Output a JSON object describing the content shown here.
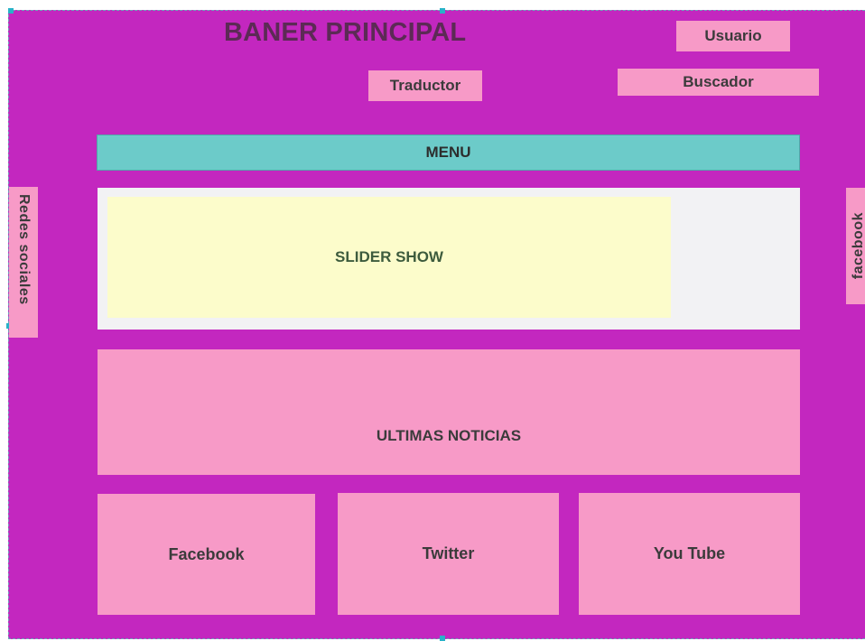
{
  "banner": {
    "title": "BANER PRINCIPAL"
  },
  "header": {
    "user": "Usuario",
    "translator": "Traductor",
    "search": "Buscador"
  },
  "menu": {
    "label": "MENU"
  },
  "slider": {
    "label": "SLIDER SHOW"
  },
  "news": {
    "label": "ULTIMAS NOTICIAS"
  },
  "social_sidebar": {
    "left": "Redes sociales",
    "right": "facebook"
  },
  "social_boxes": {
    "facebook": "Facebook",
    "twitter": "Twitter",
    "youtube": "You Tube"
  },
  "colors": {
    "background": "#c327bf",
    "pink_box": "#f79ac7",
    "menu": "#6ccbc9",
    "slider_frame": "#f2f2f4",
    "slider_inner": "#fcfccb"
  }
}
